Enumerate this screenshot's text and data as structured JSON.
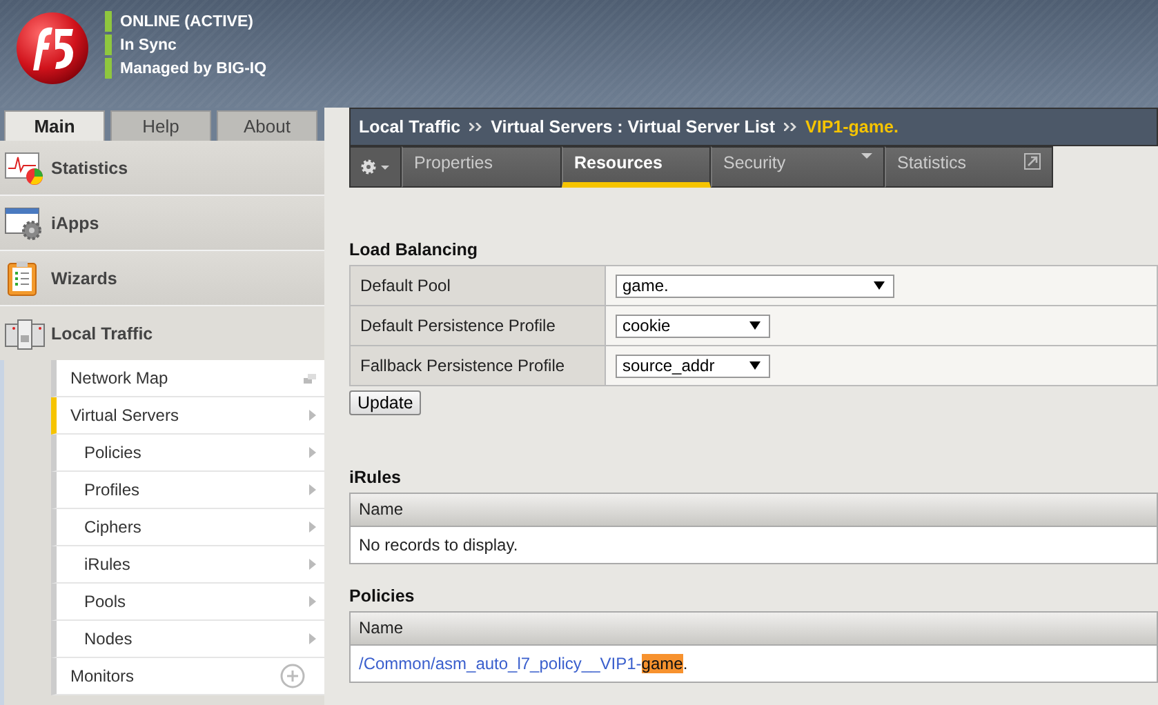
{
  "status": [
    {
      "text": "ONLINE (ACTIVE)"
    },
    {
      "text": "In Sync"
    },
    {
      "text": "Managed by BIG-IQ"
    }
  ],
  "side_tabs": [
    {
      "label": "Main",
      "selected": true
    },
    {
      "label": "Help",
      "selected": false
    },
    {
      "label": "About",
      "selected": false
    }
  ],
  "nav": [
    {
      "label": "Statistics",
      "kind": "chart",
      "expanded": false
    },
    {
      "label": "iApps",
      "kind": "app",
      "expanded": false
    },
    {
      "label": "Wizards",
      "kind": "clipboard",
      "expanded": false
    },
    {
      "label": "Local Traffic",
      "kind": "servers",
      "expanded": true
    }
  ],
  "subnav": [
    {
      "label": "Network Map",
      "kind": "window",
      "selected": false
    },
    {
      "label": "Virtual Servers",
      "kind": "arrow",
      "selected": true,
      "children": [
        {
          "label": "Policies",
          "kind": "arrow",
          "selected": false
        },
        {
          "label": "Profiles",
          "kind": "arrow",
          "selected": false
        },
        {
          "label": "Ciphers",
          "kind": "arrow",
          "selected": false
        },
        {
          "label": "iRules",
          "kind": "arrow",
          "selected": false
        },
        {
          "label": "Pools",
          "kind": "arrow",
          "selected": false
        },
        {
          "label": "Nodes",
          "kind": "arrow",
          "selected": false
        }
      ]
    },
    {
      "label": "Monitors",
      "kind": "add",
      "selected": false
    }
  ],
  "breadcrumb": {
    "parts": [
      "Local Traffic",
      "Virtual Servers : Virtual Server List"
    ],
    "current": "VIP1-game."
  },
  "tabs": [
    {
      "label": "Properties",
      "kind": "plain",
      "selected": false
    },
    {
      "label": "Resources",
      "kind": "plain",
      "selected": true
    },
    {
      "label": "Security",
      "kind": "dropdown",
      "selected": false
    },
    {
      "label": "Statistics",
      "kind": "external",
      "selected": false
    }
  ],
  "load_balancing": {
    "title": "Load Balancing",
    "rows": [
      {
        "label": "Default Pool",
        "value": "game.",
        "wide": true
      },
      {
        "label": "Default Persistence Profile",
        "value": "cookie",
        "wide": false
      },
      {
        "label": "Fallback Persistence Profile",
        "value": "source_addr",
        "wide": false
      }
    ],
    "button": "Update"
  },
  "irules": {
    "title": "iRules",
    "column": "Name",
    "empty": "No records to display."
  },
  "policies": {
    "title": "Policies",
    "column": "Name",
    "rows": [
      {
        "link": "/Common/asm_auto_l7_policy__VIP1-",
        "highlight": "game",
        "suffix": "."
      }
    ]
  }
}
